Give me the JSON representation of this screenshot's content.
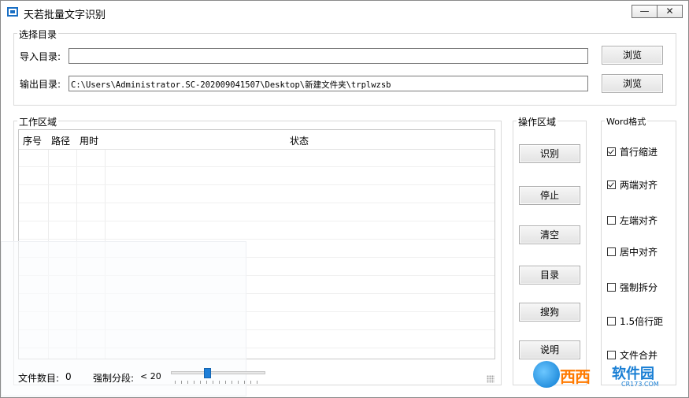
{
  "window": {
    "title": "天若批量文字识别",
    "minimize_glyph": "—",
    "close_glyph": "✕"
  },
  "select_dir": {
    "legend": "选择目录",
    "import_label": "导入目录:",
    "import_value": "",
    "output_label": "输出目录:",
    "output_value": "C:\\Users\\Administrator.SC-202009041507\\Desktop\\新建文件夹\\trplwzsb",
    "browse_label": "浏览"
  },
  "work_area": {
    "legend": "工作区域",
    "columns": [
      "序号",
      "路径",
      "用时",
      "状态"
    ],
    "rows": []
  },
  "status": {
    "file_count_label": "文件数目:",
    "file_count_value": "0",
    "segment_label": "强制分段:",
    "segment_value": "< 20",
    "slider_fraction": 0.38
  },
  "ops": {
    "legend": "操作区域",
    "buttons": [
      "识别",
      "停止",
      "清空",
      "目录",
      "搜狗",
      "说明"
    ]
  },
  "word": {
    "legend": "Word格式",
    "options": [
      {
        "label": "首行缩进",
        "checked": true
      },
      {
        "label": "两端对齐",
        "checked": true
      },
      {
        "label": "左端对齐",
        "checked": false
      },
      {
        "label": "居中对齐",
        "checked": false
      },
      {
        "label": "强制拆分",
        "checked": false
      },
      {
        "label": "1.5倍行距",
        "checked": false
      },
      {
        "label": "文件合并",
        "checked": false
      }
    ]
  },
  "watermark": {
    "brand": "西西",
    "brand2": "软件园",
    "domain": "CR173.COM"
  },
  "colors": {
    "accent": "#1e7fd8"
  }
}
